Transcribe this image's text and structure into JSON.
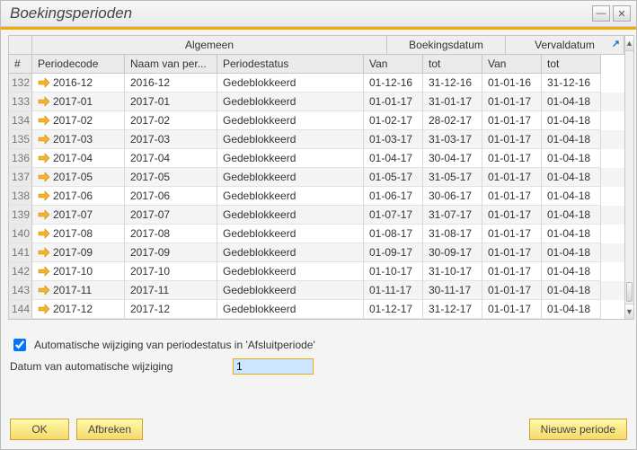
{
  "title": "Boekingsperioden",
  "groups": {
    "idx": "#",
    "algemeen": "Algemeen",
    "boekingsdatum": "Boekingsdatum",
    "vervaldatum": "Vervaldatum"
  },
  "columns": {
    "periodecode": "Periodecode",
    "naam": "Naam van per...",
    "status": "Periodestatus",
    "van": "Van",
    "tot": "tot"
  },
  "rows": [
    {
      "n": "132",
      "code": "2016-12",
      "name": "2016-12",
      "status": "Gedeblokkeerd",
      "bvan": "01-12-16",
      "btot": "31-12-16",
      "vvan": "01-01-16",
      "vtot": "31-12-16"
    },
    {
      "n": "133",
      "code": "2017-01",
      "name": "2017-01",
      "status": "Gedeblokkeerd",
      "bvan": "01-01-17",
      "btot": "31-01-17",
      "vvan": "01-01-17",
      "vtot": "01-04-18"
    },
    {
      "n": "134",
      "code": "2017-02",
      "name": "2017-02",
      "status": "Gedeblokkeerd",
      "bvan": "01-02-17",
      "btot": "28-02-17",
      "vvan": "01-01-17",
      "vtot": "01-04-18"
    },
    {
      "n": "135",
      "code": "2017-03",
      "name": "2017-03",
      "status": "Gedeblokkeerd",
      "bvan": "01-03-17",
      "btot": "31-03-17",
      "vvan": "01-01-17",
      "vtot": "01-04-18"
    },
    {
      "n": "136",
      "code": "2017-04",
      "name": "2017-04",
      "status": "Gedeblokkeerd",
      "bvan": "01-04-17",
      "btot": "30-04-17",
      "vvan": "01-01-17",
      "vtot": "01-04-18"
    },
    {
      "n": "137",
      "code": "2017-05",
      "name": "2017-05",
      "status": "Gedeblokkeerd",
      "bvan": "01-05-17",
      "btot": "31-05-17",
      "vvan": "01-01-17",
      "vtot": "01-04-18"
    },
    {
      "n": "138",
      "code": "2017-06",
      "name": "2017-06",
      "status": "Gedeblokkeerd",
      "bvan": "01-06-17",
      "btot": "30-06-17",
      "vvan": "01-01-17",
      "vtot": "01-04-18"
    },
    {
      "n": "139",
      "code": "2017-07",
      "name": "2017-07",
      "status": "Gedeblokkeerd",
      "bvan": "01-07-17",
      "btot": "31-07-17",
      "vvan": "01-01-17",
      "vtot": "01-04-18"
    },
    {
      "n": "140",
      "code": "2017-08",
      "name": "2017-08",
      "status": "Gedeblokkeerd",
      "bvan": "01-08-17",
      "btot": "31-08-17",
      "vvan": "01-01-17",
      "vtot": "01-04-18"
    },
    {
      "n": "141",
      "code": "2017-09",
      "name": "2017-09",
      "status": "Gedeblokkeerd",
      "bvan": "01-09-17",
      "btot": "30-09-17",
      "vvan": "01-01-17",
      "vtot": "01-04-18"
    },
    {
      "n": "142",
      "code": "2017-10",
      "name": "2017-10",
      "status": "Gedeblokkeerd",
      "bvan": "01-10-17",
      "btot": "31-10-17",
      "vvan": "01-01-17",
      "vtot": "01-04-18"
    },
    {
      "n": "143",
      "code": "2017-11",
      "name": "2017-11",
      "status": "Gedeblokkeerd",
      "bvan": "01-11-17",
      "btot": "30-11-17",
      "vvan": "01-01-17",
      "vtot": "01-04-18"
    },
    {
      "n": "144",
      "code": "2017-12",
      "name": "2017-12",
      "status": "Gedeblokkeerd",
      "bvan": "01-12-17",
      "btot": "31-12-17",
      "vvan": "01-01-17",
      "vtot": "01-04-18"
    }
  ],
  "checkbox_label": "Automatische wijziging van periodestatus in 'Afsluitperiode'",
  "checkbox_checked": true,
  "date_label": "Datum van automatische wijziging",
  "date_value": "1",
  "buttons": {
    "ok": "OK",
    "cancel": "Afbreken",
    "new": "Nieuwe periode"
  },
  "link_icon": "↗"
}
